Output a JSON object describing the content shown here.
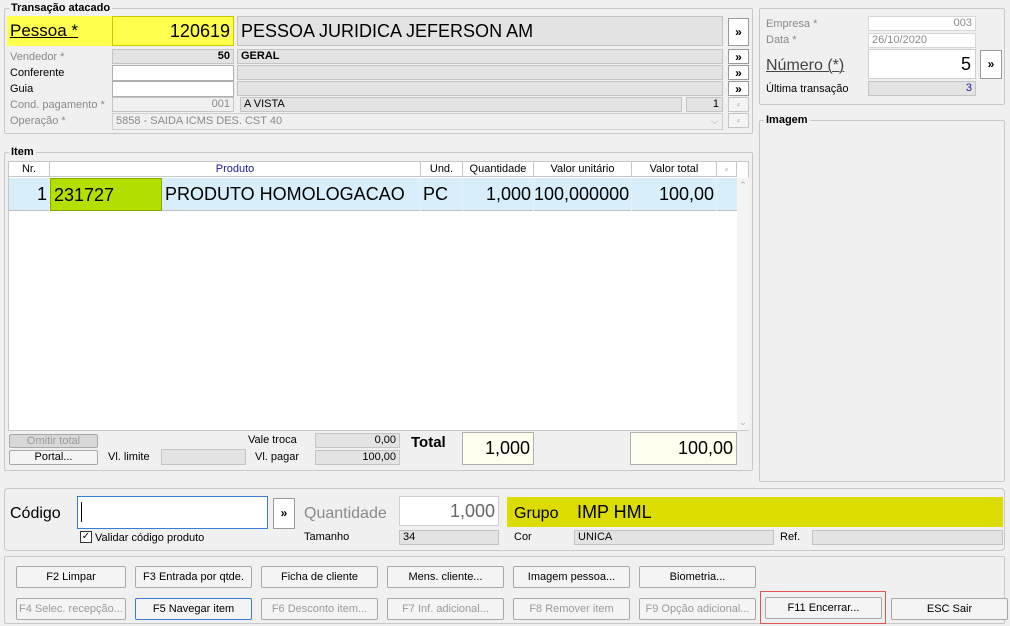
{
  "transaction": {
    "group_title": "Transação atacado",
    "pessoa": {
      "label": "Pessoa *",
      "code": "120619",
      "name": "PESSOA JURIDICA JEFERSON AM"
    },
    "vendedor": {
      "label": "Vendedor *",
      "code": "50",
      "name": "GERAL"
    },
    "conferente": {
      "label": "Conferente",
      "code": "",
      "name": ""
    },
    "guia": {
      "label": "Guia",
      "code": "",
      "name": ""
    },
    "cond_pagamento": {
      "label": "Cond. pagamento *",
      "code": "001",
      "name": "A VISTA",
      "parcelas": "1"
    },
    "operacao": {
      "label": "Operação *",
      "value": "5858 - SAIDA ICMS DES. CST 40"
    },
    "arrow": "»"
  },
  "right_panel": {
    "empresa": {
      "label": "Empresa *",
      "value": "003"
    },
    "data": {
      "label": "Data *",
      "value": "26/10/2020"
    },
    "numero": {
      "label": "Número (*)",
      "value": "5"
    },
    "ultima": {
      "label": "Última transação",
      "value": "3"
    },
    "imagem_title": "Imagem"
  },
  "items": {
    "group_title": "Item",
    "columns": [
      "Nr.",
      "Produto",
      "Und.",
      "Quantidade",
      "Valor unitário",
      "Valor total"
    ],
    "rows": [
      {
        "nr": "1",
        "codigo": "231727",
        "produto": "PRODUTO HOMOLOGACAO",
        "und": "PC",
        "quantidade": "1,000",
        "valor_unitario": "100,000000",
        "valor_total": "100,00"
      }
    ]
  },
  "footer_totals": {
    "omitir_total": "Omitir total",
    "portal": "Portal...",
    "vl_limite_label": "Vl. limite",
    "vl_limite": "",
    "vale_troca_label": "Vale troca",
    "vale_troca": "0,00",
    "vl_pagar_label": "Vl. pagar",
    "vl_pagar": "100,00",
    "total_label": "Total",
    "total_qtd": "1,000",
    "total_valor": "100,00"
  },
  "entry": {
    "codigo_label": "Código",
    "codigo_value": "",
    "validar_label": "Validar código produto",
    "validar_checked": true,
    "quantidade_label": "Quantidade",
    "quantidade_value": "1,000",
    "tamanho_label": "Tamanho",
    "tamanho_value": "34",
    "grupo_label": "Grupo",
    "grupo_value": "IMP HML",
    "cor_label": "Cor",
    "cor_value": "UNICA",
    "ref_label": "Ref.",
    "ref_value": ""
  },
  "buttons": {
    "f2": "F2 Limpar",
    "f3": "F3 Entrada por qtde.",
    "ficha": "Ficha de cliente",
    "mens": "Mens. cliente...",
    "imagem_pessoa": "Imagem pessoa...",
    "biometria": "Biometria...",
    "f4": "F4 Selec. recepção...",
    "f5": "F5 Navegar item",
    "f6": "F6 Desconto item...",
    "f7": "F7 Inf. adicional...",
    "f8": "F8 Remover item",
    "f9": "F9 Opção adicional...",
    "f11": "F11 Encerrar...",
    "esc": "ESC Sair"
  },
  "colors": {
    "highlight_yellow": "#ffff4d",
    "grupo_yellow": "#dcdc00",
    "code_green": "#b4e000",
    "row_blue": "#d8eefa",
    "total_bg": "#fffff0",
    "focus_red": "#e05555"
  }
}
